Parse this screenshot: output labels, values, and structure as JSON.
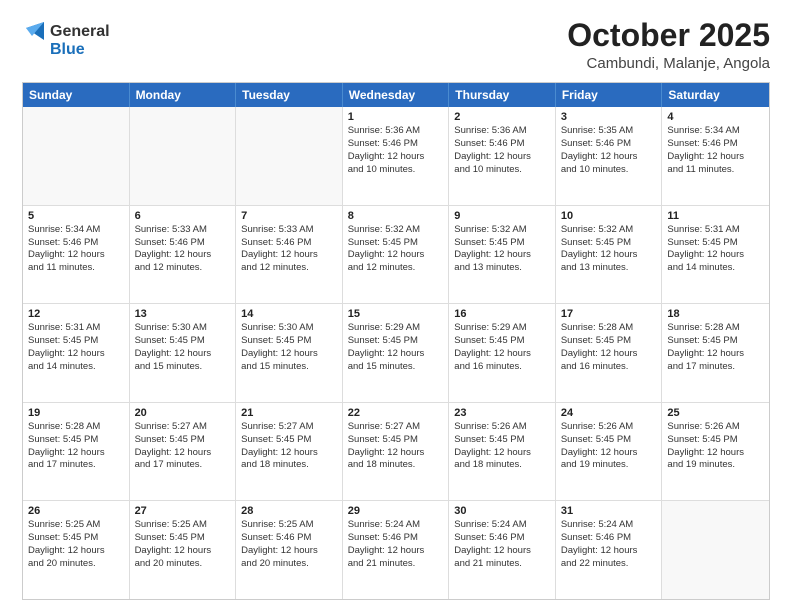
{
  "header": {
    "logo_general": "General",
    "logo_blue": "Blue",
    "month_title": "October 2025",
    "location": "Cambundi, Malanje, Angola"
  },
  "calendar": {
    "days_of_week": [
      "Sunday",
      "Monday",
      "Tuesday",
      "Wednesday",
      "Thursday",
      "Friday",
      "Saturday"
    ],
    "weeks": [
      [
        {
          "day": "",
          "info": ""
        },
        {
          "day": "",
          "info": ""
        },
        {
          "day": "",
          "info": ""
        },
        {
          "day": "1",
          "info": "Sunrise: 5:36 AM\nSunset: 5:46 PM\nDaylight: 12 hours\nand 10 minutes."
        },
        {
          "day": "2",
          "info": "Sunrise: 5:36 AM\nSunset: 5:46 PM\nDaylight: 12 hours\nand 10 minutes."
        },
        {
          "day": "3",
          "info": "Sunrise: 5:35 AM\nSunset: 5:46 PM\nDaylight: 12 hours\nand 10 minutes."
        },
        {
          "day": "4",
          "info": "Sunrise: 5:34 AM\nSunset: 5:46 PM\nDaylight: 12 hours\nand 11 minutes."
        }
      ],
      [
        {
          "day": "5",
          "info": "Sunrise: 5:34 AM\nSunset: 5:46 PM\nDaylight: 12 hours\nand 11 minutes."
        },
        {
          "day": "6",
          "info": "Sunrise: 5:33 AM\nSunset: 5:46 PM\nDaylight: 12 hours\nand 12 minutes."
        },
        {
          "day": "7",
          "info": "Sunrise: 5:33 AM\nSunset: 5:46 PM\nDaylight: 12 hours\nand 12 minutes."
        },
        {
          "day": "8",
          "info": "Sunrise: 5:32 AM\nSunset: 5:45 PM\nDaylight: 12 hours\nand 12 minutes."
        },
        {
          "day": "9",
          "info": "Sunrise: 5:32 AM\nSunset: 5:45 PM\nDaylight: 12 hours\nand 13 minutes."
        },
        {
          "day": "10",
          "info": "Sunrise: 5:32 AM\nSunset: 5:45 PM\nDaylight: 12 hours\nand 13 minutes."
        },
        {
          "day": "11",
          "info": "Sunrise: 5:31 AM\nSunset: 5:45 PM\nDaylight: 12 hours\nand 14 minutes."
        }
      ],
      [
        {
          "day": "12",
          "info": "Sunrise: 5:31 AM\nSunset: 5:45 PM\nDaylight: 12 hours\nand 14 minutes."
        },
        {
          "day": "13",
          "info": "Sunrise: 5:30 AM\nSunset: 5:45 PM\nDaylight: 12 hours\nand 15 minutes."
        },
        {
          "day": "14",
          "info": "Sunrise: 5:30 AM\nSunset: 5:45 PM\nDaylight: 12 hours\nand 15 minutes."
        },
        {
          "day": "15",
          "info": "Sunrise: 5:29 AM\nSunset: 5:45 PM\nDaylight: 12 hours\nand 15 minutes."
        },
        {
          "day": "16",
          "info": "Sunrise: 5:29 AM\nSunset: 5:45 PM\nDaylight: 12 hours\nand 16 minutes."
        },
        {
          "day": "17",
          "info": "Sunrise: 5:28 AM\nSunset: 5:45 PM\nDaylight: 12 hours\nand 16 minutes."
        },
        {
          "day": "18",
          "info": "Sunrise: 5:28 AM\nSunset: 5:45 PM\nDaylight: 12 hours\nand 17 minutes."
        }
      ],
      [
        {
          "day": "19",
          "info": "Sunrise: 5:28 AM\nSunset: 5:45 PM\nDaylight: 12 hours\nand 17 minutes."
        },
        {
          "day": "20",
          "info": "Sunrise: 5:27 AM\nSunset: 5:45 PM\nDaylight: 12 hours\nand 17 minutes."
        },
        {
          "day": "21",
          "info": "Sunrise: 5:27 AM\nSunset: 5:45 PM\nDaylight: 12 hours\nand 18 minutes."
        },
        {
          "day": "22",
          "info": "Sunrise: 5:27 AM\nSunset: 5:45 PM\nDaylight: 12 hours\nand 18 minutes."
        },
        {
          "day": "23",
          "info": "Sunrise: 5:26 AM\nSunset: 5:45 PM\nDaylight: 12 hours\nand 18 minutes."
        },
        {
          "day": "24",
          "info": "Sunrise: 5:26 AM\nSunset: 5:45 PM\nDaylight: 12 hours\nand 19 minutes."
        },
        {
          "day": "25",
          "info": "Sunrise: 5:26 AM\nSunset: 5:45 PM\nDaylight: 12 hours\nand 19 minutes."
        }
      ],
      [
        {
          "day": "26",
          "info": "Sunrise: 5:25 AM\nSunset: 5:45 PM\nDaylight: 12 hours\nand 20 minutes."
        },
        {
          "day": "27",
          "info": "Sunrise: 5:25 AM\nSunset: 5:45 PM\nDaylight: 12 hours\nand 20 minutes."
        },
        {
          "day": "28",
          "info": "Sunrise: 5:25 AM\nSunset: 5:46 PM\nDaylight: 12 hours\nand 20 minutes."
        },
        {
          "day": "29",
          "info": "Sunrise: 5:24 AM\nSunset: 5:46 PM\nDaylight: 12 hours\nand 21 minutes."
        },
        {
          "day": "30",
          "info": "Sunrise: 5:24 AM\nSunset: 5:46 PM\nDaylight: 12 hours\nand 21 minutes."
        },
        {
          "day": "31",
          "info": "Sunrise: 5:24 AM\nSunset: 5:46 PM\nDaylight: 12 hours\nand 22 minutes."
        },
        {
          "day": "",
          "info": ""
        }
      ]
    ]
  }
}
